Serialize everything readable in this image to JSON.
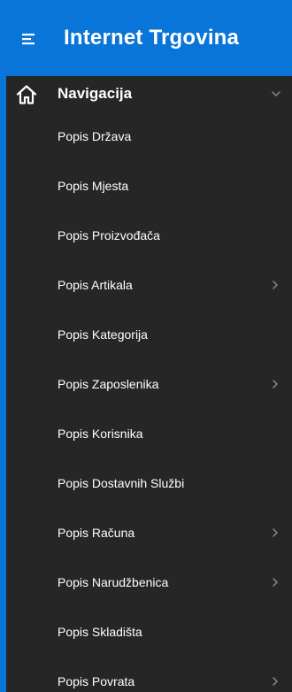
{
  "colors": {
    "header_bg": "#0a75d8",
    "sidebar_bg": "#262626",
    "text": "#ffffff",
    "chevron": "#8a8a8a"
  },
  "header": {
    "menu_icon": "hamburger-menu-icon",
    "title": "Internet Trgovina"
  },
  "nav": {
    "root": {
      "label": "Navigacija",
      "icon": "home-icon",
      "expanded": true
    },
    "items": [
      {
        "label": "Popis Država",
        "has_children": false
      },
      {
        "label": "Popis Mjesta",
        "has_children": false
      },
      {
        "label": "Popis Proizvođača",
        "has_children": false
      },
      {
        "label": "Popis Artikala",
        "has_children": true
      },
      {
        "label": "Popis Kategorija",
        "has_children": false
      },
      {
        "label": "Popis Zaposlenika",
        "has_children": true
      },
      {
        "label": "Popis Korisnika",
        "has_children": false
      },
      {
        "label": "Popis Dostavnih Službi",
        "has_children": false
      },
      {
        "label": "Popis Računa",
        "has_children": true
      },
      {
        "label": "Popis Narudžbenica",
        "has_children": true
      },
      {
        "label": "Popis Skladišta",
        "has_children": false
      },
      {
        "label": "Popis Povrata",
        "has_children": true
      }
    ]
  }
}
